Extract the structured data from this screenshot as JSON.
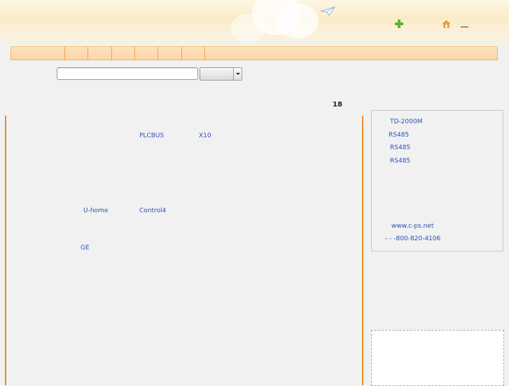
{
  "header": {
    "icons": [
      "paper-plane-icon",
      "plus-icon",
      "home-icon",
      "minimize-icon"
    ]
  },
  "nav": {
    "items": [
      "",
      "",
      "",
      "",
      "",
      "",
      "",
      ""
    ]
  },
  "search": {
    "value": "",
    "placeholder": "",
    "select_value": ""
  },
  "results": {
    "count": "18"
  },
  "main": {
    "links": {
      "plcbus": "PLCBUS",
      "x10": "X10",
      "uhome": "U-home",
      "control4": "Control4",
      "ge": "GE"
    }
  },
  "sidebar": {
    "lines": [
      "TD-2000M",
      "RS485",
      "RS485",
      "RS485"
    ],
    "website": "www.c-ps.net",
    "phone": "- - -800-820-4106"
  },
  "colors": {
    "accent_orange": "#f08a2c",
    "link_blue": "#2752b8",
    "nav_bg": "#fbd6a6"
  }
}
